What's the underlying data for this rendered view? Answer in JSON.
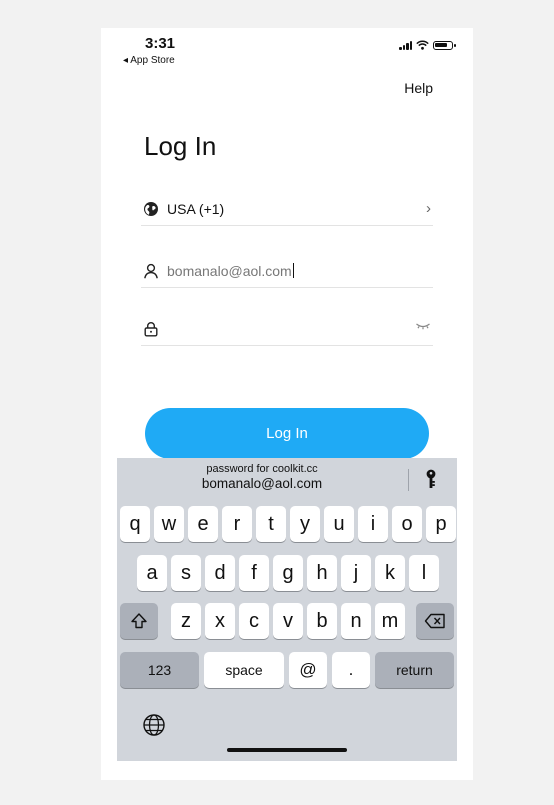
{
  "status": {
    "time": "3:31",
    "back_label": "◂ App Store"
  },
  "header": {
    "help_label": "Help"
  },
  "page": {
    "title": "Log In"
  },
  "form": {
    "country_label": "USA (+1)",
    "email_value": "bomanalo@aol.com",
    "password_value": ""
  },
  "login_button_label": "Log In",
  "keyboard": {
    "suggestion_caption": "password for coolkit.cc",
    "suggestion_value": "bomanalo@aol.com",
    "row1": [
      "q",
      "w",
      "e",
      "r",
      "t",
      "y",
      "u",
      "i",
      "o",
      "p"
    ],
    "row2": [
      "a",
      "s",
      "d",
      "f",
      "g",
      "h",
      "j",
      "k",
      "l"
    ],
    "row3": [
      "z",
      "x",
      "c",
      "v",
      "b",
      "n",
      "m"
    ],
    "numbers_label": "123",
    "space_label": "space",
    "at_label": "@",
    "dot_label": ".",
    "return_label": "return"
  },
  "colors": {
    "accent": "#1faaf5",
    "keyboard_bg": "#d1d5db",
    "key_dark": "#abb0b9"
  },
  "icons": [
    "globe-icon",
    "user-icon",
    "lock-icon",
    "eye-closed-icon",
    "chevron-right-icon",
    "key-icon",
    "shift-icon",
    "backspace-icon",
    "keyboard-globe-icon"
  ]
}
